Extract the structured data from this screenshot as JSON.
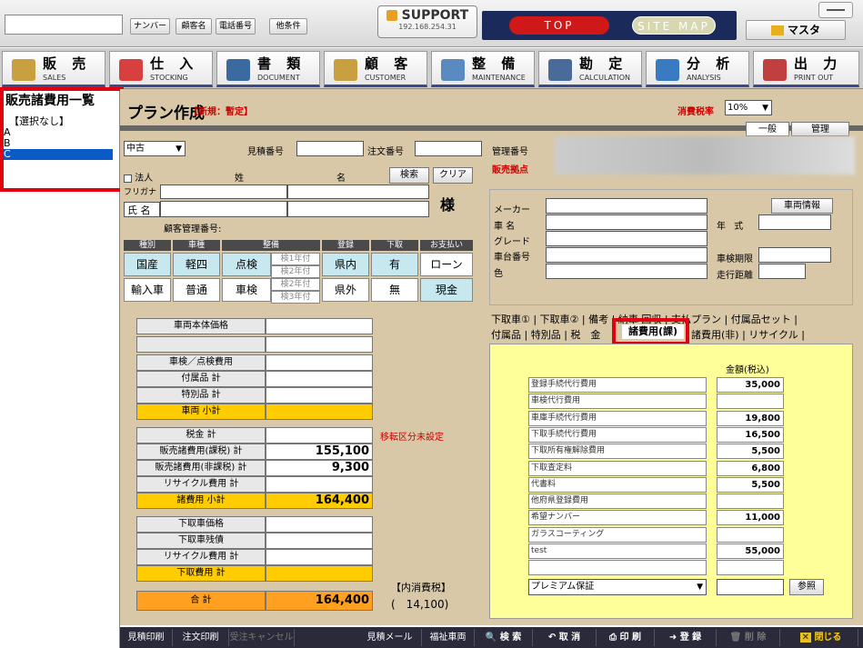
{
  "topbar": {
    "search_value": "",
    "tabs": [
      "ナンバー",
      "顧客名",
      "電話番号",
      "他条件"
    ],
    "support_label": "SUPPORT",
    "support_ip": "192.168.254.31",
    "top_label": "TOP",
    "sitemap_label": "SITE MAP",
    "master_label": "マスタ"
  },
  "menu": [
    {
      "jp": "販 売",
      "en": "SALES",
      "color": "#c9a040"
    },
    {
      "jp": "仕 入",
      "en": "STOCKING",
      "color": "#d84040"
    },
    {
      "jp": "書 類",
      "en": "DOCUMENT",
      "color": "#3a6aa0"
    },
    {
      "jp": "顧 客",
      "en": "CUSTOMER",
      "color": "#c9a040"
    },
    {
      "jp": "整 備",
      "en": "MAINTENANCE",
      "color": "#5a8ac0"
    },
    {
      "jp": "勘 定",
      "en": "CALCULATION",
      "color": "#4a6a9a"
    },
    {
      "jp": "分 析",
      "en": "ANALYSIS",
      "color": "#3a7ac0"
    },
    {
      "jp": "出 力",
      "en": "PRINT OUT",
      "color": "#c04040"
    }
  ],
  "left": {
    "title": "販売諸費用一覧",
    "items": [
      "【選択なし】",
      "A",
      "B",
      "C"
    ]
  },
  "page": {
    "title": "プラン作成",
    "status": "【新規：暫定】",
    "tax_label": "消費税率",
    "tax_value": "10%",
    "tab_general": "一般",
    "tab_manage": "管理",
    "condition": "中古",
    "estimate_no_label": "見積番号",
    "order_no_label": "注文番号",
    "manage_no_label": "管理番号",
    "sales_point_label": "販売拠点"
  },
  "customer": {
    "corp_label": "法人",
    "sei_label": "姓",
    "mei_label": "名",
    "search_btn": "検索",
    "clear_btn": "クリア",
    "furigana_label": "フリガナ",
    "name_label": "氏 名",
    "sama": "様",
    "customer_no_label": "顧客管理番号:"
  },
  "options": {
    "headers": [
      "種別",
      "車種",
      "整備",
      "登録",
      "下取",
      "お支払い"
    ],
    "row1": [
      "国産",
      "軽四",
      "点検",
      "県内",
      "有",
      "ローン"
    ],
    "row2": [
      "輸入車",
      "普通",
      "車検",
      "県外",
      "無",
      "現金"
    ],
    "sub": [
      "検1年付",
      "検2年付",
      "検3年付"
    ]
  },
  "vehicle": {
    "maker": "メーカー",
    "name": "車 名",
    "grade": "グレード",
    "chassis": "車台番号",
    "color": "色",
    "info_btn": "車両情報",
    "year": "年 式",
    "inspection": "車検期限",
    "mileage": "走行距離"
  },
  "totals": [
    {
      "label": "車両本体価格",
      "value": "",
      "style": ""
    },
    {
      "label": "",
      "value": "",
      "style": ""
    },
    {
      "label": "車検／点検費用",
      "value": "",
      "style": ""
    },
    {
      "label": "付属品 計",
      "value": "",
      "style": ""
    },
    {
      "label": "特別品 計",
      "value": "",
      "style": ""
    },
    {
      "label": "車両 小計",
      "value": "",
      "style": "y"
    },
    {
      "label": "税金 計",
      "value": "",
      "style": ""
    },
    {
      "label": "販売諸費用(課税) 計",
      "value": "155,100",
      "style": ""
    },
    {
      "label": "販売諸費用(非課税) 計",
      "value": "9,300",
      "style": ""
    },
    {
      "label": "リサイクル費用 計",
      "value": "",
      "style": ""
    },
    {
      "label": "諸費用 小計",
      "value": "164,400",
      "style": "y"
    },
    {
      "label": "下取車価格",
      "value": "",
      "style": ""
    },
    {
      "label": "下取車残債",
      "value": "",
      "style": ""
    },
    {
      "label": "リサイクル費用 計",
      "value": "",
      "style": ""
    },
    {
      "label": "下取費用 計",
      "value": "",
      "style": "y"
    },
    {
      "label": "合 計",
      "value": "164,400",
      "style": "o"
    }
  ],
  "transfer_note": "移転区分未設定",
  "inner_tax_label": "【内消費税】",
  "inner_tax_value": "(　14,100)",
  "tabs_row1": "下取車① | 下取車② | 備考 | 納車 回収 | 支払プラン | 付属品セット |",
  "tabs_row2_left": "付属品 | 特別品 | 税　金",
  "tab_active": "諸費用(課)",
  "tabs_row2_right": "諸費用(非) | リサイクル |",
  "fees_header": "金額(税込)",
  "fees": [
    {
      "label": "登録手続代行費用",
      "value": "35,000"
    },
    {
      "label": "車検代行費用",
      "value": ""
    },
    {
      "label": "車庫手続代行費用",
      "value": "19,800"
    },
    {
      "label": "下取手続代行費用",
      "value": "16,500"
    },
    {
      "label": "下取所有権解除費用",
      "value": "5,500"
    },
    {
      "label": "下取査定料",
      "value": "6,800"
    },
    {
      "label": "代書料",
      "value": "5,500"
    },
    {
      "label": "他府県登録費用",
      "value": ""
    },
    {
      "label": "希望ナンバー",
      "value": "11,000"
    },
    {
      "label": "ガラスコーティング",
      "value": ""
    },
    {
      "label": "test",
      "value": "55,000"
    },
    {
      "label": "",
      "value": ""
    }
  ],
  "fee_select": "プレミアム保証",
  "ref_btn": "参照",
  "bottom": [
    "見積印刷",
    "注文印刷",
    "受注キャンセル",
    "見積メール",
    "福祉車両",
    "検 索",
    "取 消",
    "印 刷",
    "登 録",
    "削 除",
    "閉じる"
  ]
}
